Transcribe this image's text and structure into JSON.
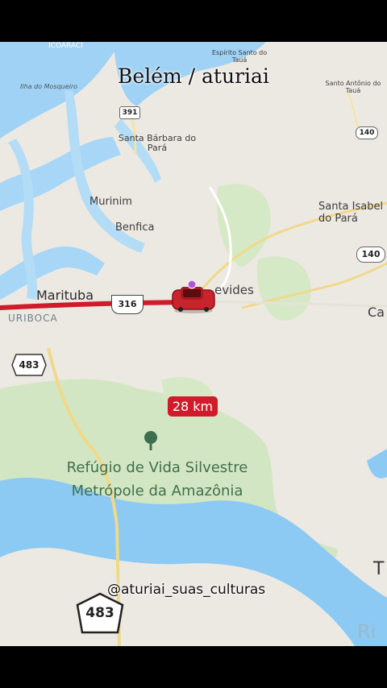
{
  "overlay": {
    "title": "Belém / aturiai",
    "watermark": "@aturiai_suas_culturas"
  },
  "map": {
    "places": {
      "icoaraci": "ICOARACI",
      "ilha_mosqueiro": "Ilha do Mosqueiro",
      "espirito_santo": "Espírito Santo do Tauá",
      "santo_antonio": "Santo Antônio do Tauá",
      "santa_barbara": "Santa Bárbara do Pará",
      "murinim": "Murinim",
      "benfica": "Benfica",
      "santa_isabel": "Santa Isabel do Pará",
      "marituba": "Marituba",
      "uriboca": "URIBOCA",
      "benevides": "evides",
      "ca": "Ca",
      "refugio": "Refúgio de Vida Silvestre Metrópole da Amazônia",
      "edge_t": "T",
      "edge_ri": "Ri"
    },
    "route_badge": "28 km",
    "road_shields": {
      "br_391": "391",
      "pa_140_a": "140",
      "pa_140_b": "140",
      "br_316": "316",
      "br_483_a": "483",
      "br_483_b": "483"
    },
    "colors": {
      "water": "#9fd2f5",
      "land": "#ece9e3",
      "park": "#d3e6c3",
      "route": "#d11a2a",
      "road": "#f0d98a"
    },
    "icons": [
      "car-marker-icon",
      "park-tree-icon"
    ]
  }
}
